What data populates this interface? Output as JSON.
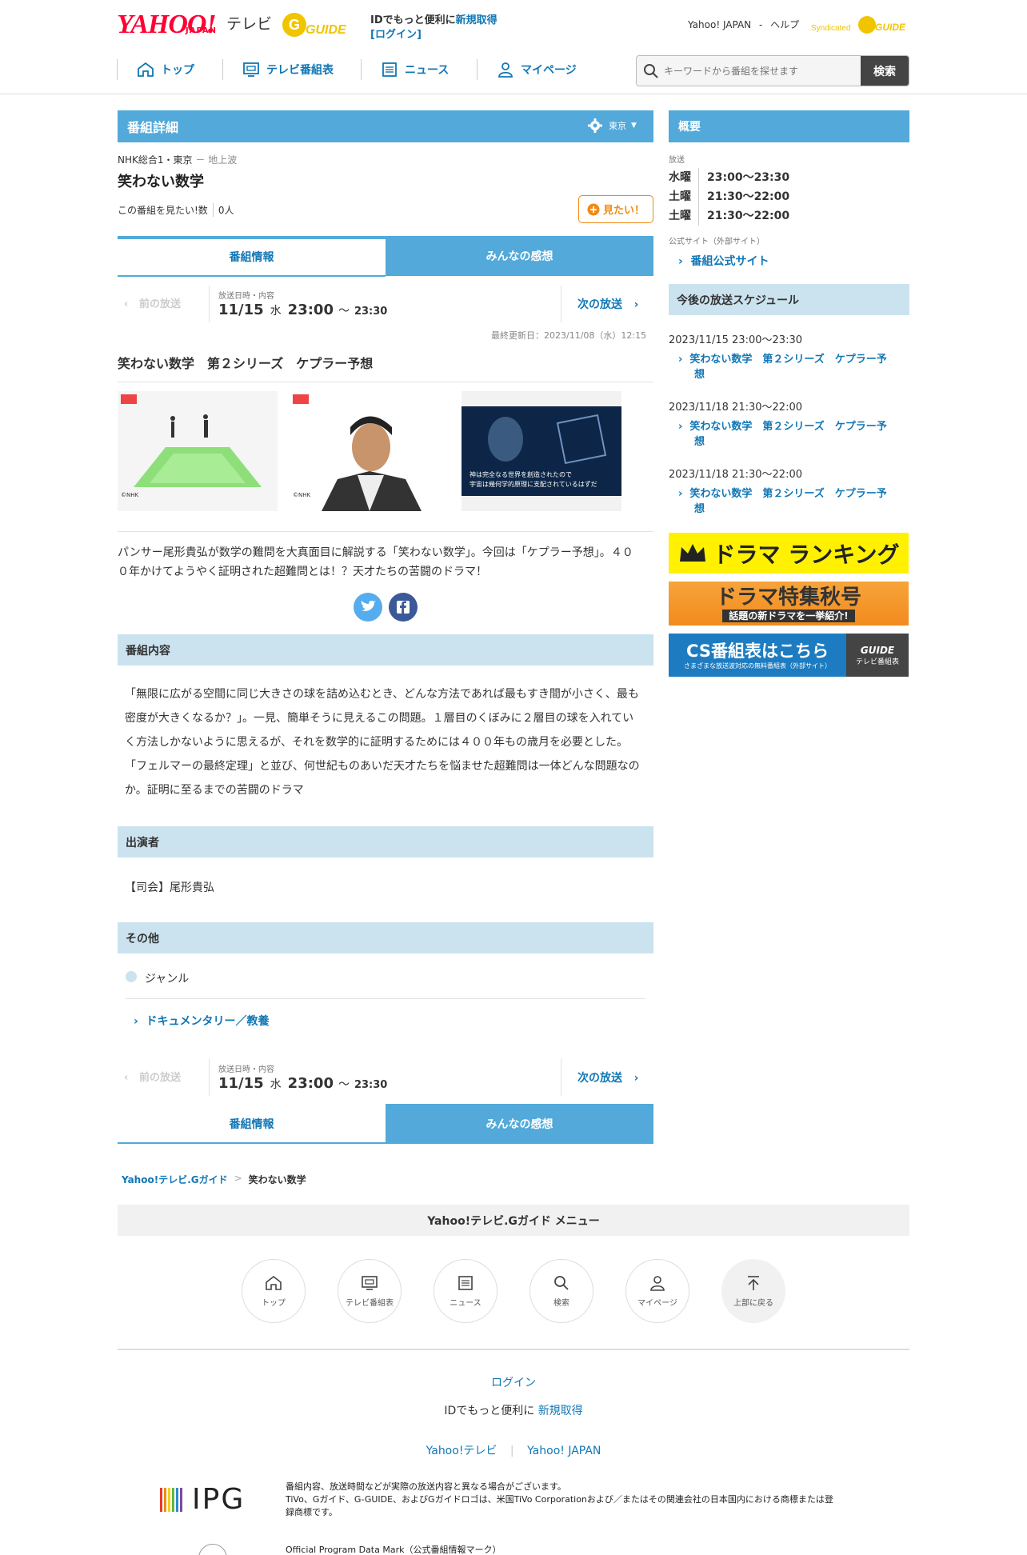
{
  "header": {
    "logo": "YAHOO!",
    "logo_sub": "JAPAN",
    "logo_tv": "テレビ",
    "gguide_logo": "G-GUIDE",
    "id_text": "IDでもっと便利に",
    "register": "新規取得",
    "login": "[ログイン]",
    "yahoo_japan": "Yahoo! JAPAN",
    "sep": "-",
    "help": "ヘルプ",
    "syndicated": "Syndicated",
    "nav": [
      {
        "label": "トップ",
        "icon": "home-icon"
      },
      {
        "label": "テレビ番組表",
        "icon": "tv-icon"
      },
      {
        "label": "ニュース",
        "icon": "news-icon"
      },
      {
        "label": "マイページ",
        "icon": "user-icon"
      }
    ],
    "search_placeholder": "キーワードから番組を探せます",
    "search_button": "検索"
  },
  "detail": {
    "title_bar": "番組詳細",
    "region": "東京",
    "channel": "NHK総合1・東京",
    "channel_sep": "－",
    "channel_type": "地上波",
    "program_title": "笑わない数学",
    "want_label": "この番組を見たい!数",
    "want_count": "0人",
    "want_button": "見たい！",
    "tabs": [
      "番組情報",
      "みんなの感想"
    ],
    "prev": "前の放送",
    "next": "次の放送",
    "air_label": "放送日時・内容",
    "air_date": "11/15",
    "air_dow": "水",
    "air_start": "23:00",
    "air_tilde": "〜",
    "air_end": "23:30",
    "updated": "最終更新日：2023/11/08（水）12:15",
    "episode_title": "笑わない数学　第２シリーズ　ケプラー予想",
    "thumb_credit": "©NHK",
    "thumb3_text1": "神は完全なる世界を創造されたので",
    "thumb3_text2": "宇宙は幾何学的原理に支配されているはずだ",
    "summary1": "パンサー尾形貴弘が数学の難問を大真面目に解説する「笑わない数学」。今回は「ケプラー予想」。４０",
    "summary2": "０年かけてようやく証明された超難問とは！？天才たちの苦闘のドラマ！",
    "content_header": "番組内容",
    "content": [
      "「無限に広がる空間に同じ大きさの球を詰め込むとき、どんな方法であれば最もすき間が小さく、最も",
      "密度が大きくなるか？」。一見、簡単そうに見えるこの問題。１層目のくぼみに２層目の球を入れてい",
      "く方法しかないように思えるが、それを数学的に証明するためには４００年もの歳月を必要とした。",
      "「フェルマーの最終定理」と並び、何世紀ものあいだ天才たちを悩ませた超難問は一体どんな問題なの",
      "か。証明に至るまでの苦闘のドラマ"
    ],
    "cast_header": "出演者",
    "cast": "【司会】尾形貴弘",
    "other_header": "その他",
    "genre_label": "ジャンル",
    "genre": "ドキュメンタリー／教養"
  },
  "sidebar": {
    "overview": "概要",
    "broadcast_label": "放送",
    "broadcasts": [
      {
        "day": "水曜",
        "time": "23:00〜23:30"
      },
      {
        "day": "土曜",
        "time": "21:30〜22:00"
      },
      {
        "day": "土曜",
        "time": "21:30〜22:00"
      }
    ],
    "official_label": "公式サイト（外部サイト）",
    "official_link": "番組公式サイト",
    "schedule_header": "今後の放送スケジュール",
    "schedule": [
      {
        "date": "2023/11/15 23:00〜23:30",
        "t1": "笑わない数学　第２シリーズ　ケプラー予",
        "t2": "想"
      },
      {
        "date": "2023/11/18 21:30〜22:00",
        "t1": "笑わない数学　第２シリーズ　ケプラー予",
        "t2": "想"
      },
      {
        "date": "2023/11/18 21:30〜22:00",
        "t1": "笑わない数学　第２シリーズ　ケプラー予",
        "t2": "想"
      }
    ],
    "banner1": "ドラマ ランキング",
    "banner2": "ドラマ特集秋号",
    "banner2_sub": "話題の新ドラマを一挙紹介!",
    "banner3": "CS番組表はこちら",
    "banner3_sub": "さまざまな放送波対応の無料番組表（外部サイト）",
    "banner3_right": "テレビ番組表"
  },
  "breadcrumb": {
    "home": "Yahoo!テレビ.Gガイド",
    "sep": ">",
    "current": "笑わない数学"
  },
  "footer": {
    "menu_title": "Yahoo!テレビ.Gガイド メニュー",
    "menu": [
      {
        "label": "トップ",
        "icon": "home-icon"
      },
      {
        "label": "テレビ番組表",
        "icon": "tv-icon"
      },
      {
        "label": "ニュース",
        "icon": "news-icon"
      },
      {
        "label": "検索",
        "icon": "search-icon"
      },
      {
        "label": "マイページ",
        "icon": "user-icon"
      },
      {
        "label": "上部に戻る",
        "icon": "arrow-up-icon"
      }
    ],
    "login": "ログイン",
    "id_text": "IDでもっと便利に",
    "register": "新規取得",
    "links": [
      "Yahoo!テレビ",
      "Yahoo! JAPAN"
    ],
    "ipg": "IPG",
    "notice1": "番組内容、放送時間などが実際の放送内容と異なる場合がございます。",
    "notice2": "TiVo、Gガイド、G-GUIDE、およびGガイドロゴは、米国TiVo Corporationおよび／またはその関連会社の日本国内における商標または登",
    "notice3": "録商標です。",
    "mark": "Official Program Data Mark（公式番組情報マーク）"
  },
  "colors": {
    "accent": "#52a9da",
    "light": "#cbe3ef",
    "link": "#1277b5",
    "yahoo": "#ff0033",
    "gguide": "#f0c500",
    "orange": "#ef8a12"
  }
}
